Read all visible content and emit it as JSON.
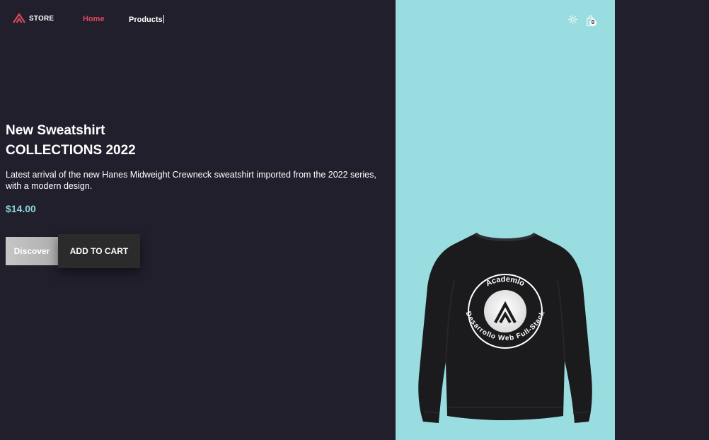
{
  "header": {
    "logo_text": "STORE",
    "nav": {
      "home": "Home",
      "products": "Products"
    },
    "cart_count": "0",
    "icons": [
      "logo-a-icon",
      "sun-icon",
      "shopping-bag-icon"
    ]
  },
  "hero": {
    "title_line1": "New Sweatshirt",
    "title_line2": "COLLECTIONS 2022",
    "description": "Latest arrival of the new Hanes Midweight Crewneck sweatshirt imported from the 2022 series, with a modern design.",
    "price": "$14.00",
    "discover_label": "Discover",
    "add_to_cart_label": "ADD TO CART"
  },
  "product_image": {
    "ring_text_top": "Academlo",
    "ring_text_bottom": "Desarrollo Web Full-Stack"
  },
  "colors": {
    "background": "#201f2b",
    "accent_red": "#e0485c",
    "panel": "#99dde0",
    "price": "#8fd3db"
  }
}
